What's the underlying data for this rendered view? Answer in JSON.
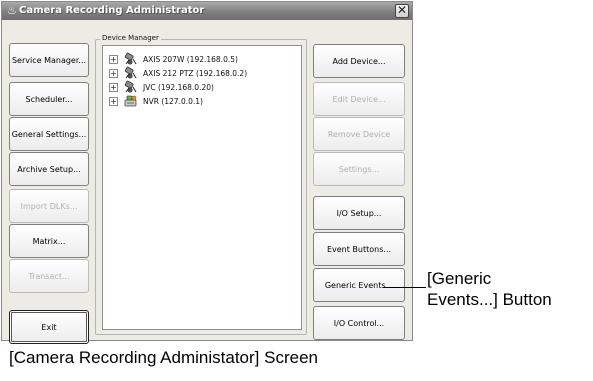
{
  "window": {
    "title": "Camera Recording Administrator",
    "close_glyph": "✕"
  },
  "left_buttons": [
    {
      "label": "Service Manager...",
      "enabled": true
    },
    {
      "label": "Scheduler...",
      "enabled": true
    },
    {
      "label": "General Settings...",
      "enabled": true
    },
    {
      "label": "Archive Setup...",
      "enabled": true
    },
    {
      "label": "Import DLKs...",
      "enabled": false
    },
    {
      "label": "Matrix...",
      "enabled": true
    },
    {
      "label": "Transact...",
      "enabled": false
    },
    {
      "label": "Exit",
      "enabled": true
    }
  ],
  "device_manager": {
    "group_label": "Device Manager",
    "items": [
      {
        "expander": "+",
        "icon": "camera-icon",
        "label": "AXIS 207W (192.168.0.5)"
      },
      {
        "expander": "+",
        "icon": "camera-icon",
        "label": "AXIS 212 PTZ (192.168.0.2)"
      },
      {
        "expander": "+",
        "icon": "camera-icon",
        "label": "JVC  (192.168.0.20)"
      },
      {
        "expander": "+",
        "icon": "nvr-icon",
        "label": "NVR (127.0.0.1)"
      }
    ]
  },
  "right_buttons": [
    {
      "label": "Add Device...",
      "enabled": true
    },
    {
      "label": "Edit Device...",
      "enabled": false
    },
    {
      "label": "Remove Device",
      "enabled": false
    },
    {
      "label": "Settings...",
      "enabled": false
    },
    {
      "label": "I/O Setup...",
      "enabled": true
    },
    {
      "label": "Event Buttons...",
      "enabled": true
    },
    {
      "label": "Generic Events...",
      "enabled": true
    },
    {
      "label": "I/O Control...",
      "enabled": true
    }
  ],
  "annotation": {
    "line1": "[Generic",
    "line2": "Events...] Button"
  },
  "caption": "[Camera Recording Administator] Screen"
}
